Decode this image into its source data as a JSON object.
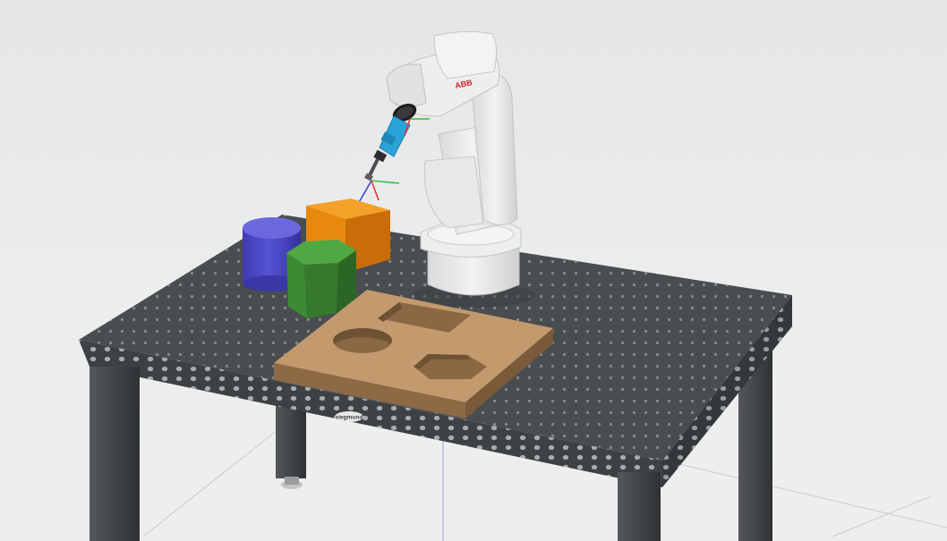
{
  "scene": {
    "background_color": "#e9eaeb",
    "table": {
      "top_color": "#4a4d50",
      "edge_color": "#3e4144",
      "leg_color": "#3a3d40",
      "hole_color": "#9ea3a7",
      "badge_text": "siegmund"
    },
    "robot": {
      "body_color": "#e6e6e6",
      "shadow_color": "#c6c7c8",
      "brand_text": "ABB",
      "brand_color": "#d01e2a",
      "tool_color": "#2aa3d8"
    },
    "objects": [
      {
        "name": "cylinder",
        "color": "#4a47c4"
      },
      {
        "name": "cube",
        "color": "#e8890e"
      },
      {
        "name": "hexagonal-prism",
        "color": "#3c8a32"
      }
    ],
    "shape_sorter_board": {
      "color": "#b2885e",
      "cutouts": [
        "rectangle",
        "circle",
        "hexagon"
      ]
    },
    "frame_axes_colors": {
      "x": "#e03030",
      "y": "#30c040",
      "z": "#3040e0"
    }
  }
}
